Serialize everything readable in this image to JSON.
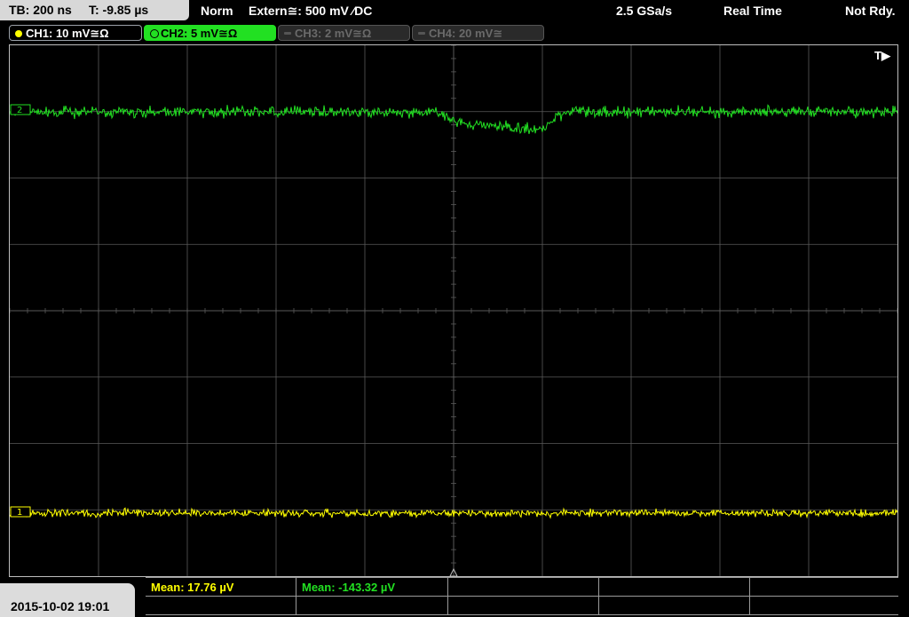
{
  "header": {
    "timebase": "TB: 200 ns",
    "trigger_time": "T: -9.85 µs",
    "acq_mode": "Norm",
    "trigger_source": "Extern≅: 500 mV ⁄DC",
    "sample_rate": "2.5 GSa/s",
    "mode": "Real Time",
    "status": "Not Rdy."
  },
  "channels": [
    {
      "label": "CH1: 10 mV≅Ω",
      "color": "#ffff00",
      "active": true
    },
    {
      "label": "CH2: 5 mV≅Ω",
      "color": "#22e022",
      "active": true
    },
    {
      "label": "CH3: 2 mV≅Ω",
      "color": "#555555",
      "active": false
    },
    {
      "label": "CH4: 20 mV≅",
      "color": "#555555",
      "active": false
    }
  ],
  "screen": {
    "trigger_marker": "T▶",
    "ch1_marker": "1",
    "ch2_marker": "2"
  },
  "footer": {
    "datetime": "2015-10-02 19:01",
    "measurements": [
      {
        "label": "Mean: 17.76 µV",
        "color": "#ffff00"
      },
      {
        "label": "Mean: -143.32 µV",
        "color": "#22e022"
      }
    ]
  },
  "colors": {
    "ch1": "#ffff00",
    "ch2": "#22e022",
    "grid": "#5a5a5a"
  }
}
